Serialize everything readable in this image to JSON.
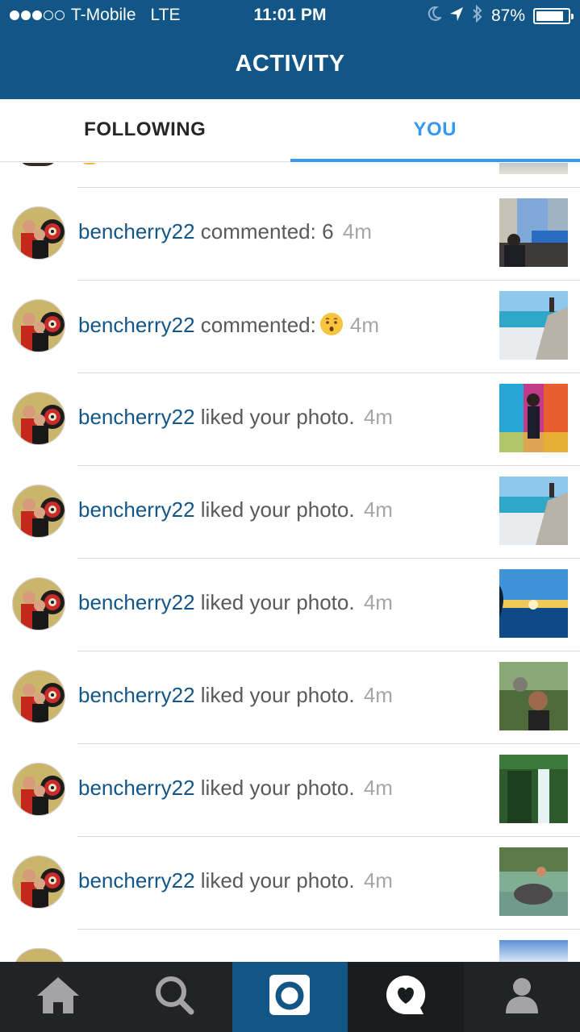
{
  "status_bar": {
    "carrier": "T-Mobile",
    "network": "LTE",
    "time": "11:01 PM",
    "battery_percent_label": "87%",
    "battery_level": 0.87,
    "icons": [
      "signal-dots",
      "moon-icon",
      "location-arrow-icon",
      "bluetooth-icon",
      "battery-icon"
    ]
  },
  "header": {
    "title": "ACTIVITY"
  },
  "tabs": [
    {
      "label": "FOLLOWING",
      "active": false
    },
    {
      "label": "YOU",
      "active": true
    }
  ],
  "activity": [
    {
      "username": "bencherry22",
      "action": "commented: 6",
      "emoji": "",
      "time": "4m",
      "thumbnail": "toronto-sign-photo"
    },
    {
      "username": "bencherry22",
      "action": "commented:",
      "emoji": "hushed-face-emoji",
      "time": "4m",
      "thumbnail": "beach-rock-photo"
    },
    {
      "username": "bencherry22",
      "action": "liked your photo.",
      "emoji": "",
      "time": "4m",
      "thumbnail": "graffiti-wall-photo"
    },
    {
      "username": "bencherry22",
      "action": "liked your photo.",
      "emoji": "",
      "time": "4m",
      "thumbnail": "beach-rock-photo"
    },
    {
      "username": "bencherry22",
      "action": "liked your photo.",
      "emoji": "",
      "time": "4m",
      "thumbnail": "sunset-ocean-photo"
    },
    {
      "username": "bencherry22",
      "action": "liked your photo.",
      "emoji": "",
      "time": "4m",
      "thumbnail": "monkey-selfie-photo"
    },
    {
      "username": "bencherry22",
      "action": "liked your photo.",
      "emoji": "",
      "time": "4m",
      "thumbnail": "waterfall-photo"
    },
    {
      "username": "bencherry22",
      "action": "liked your photo.",
      "emoji": "",
      "time": "4m",
      "thumbnail": "elephant-river-photo"
    }
  ],
  "bottom_nav": [
    {
      "name": "home-icon",
      "active": false
    },
    {
      "name": "search-icon",
      "active": false
    },
    {
      "name": "camera-icon",
      "active": false
    },
    {
      "name": "activity-heart-icon",
      "active": true
    },
    {
      "name": "profile-icon",
      "active": false
    }
  ],
  "colors": {
    "brand_blue": "#125688",
    "active_tab": "#3897f0",
    "username": "#125688",
    "action_text": "#595959",
    "timestamp": "#a6a6a6",
    "bottom_bar": "#222326"
  }
}
